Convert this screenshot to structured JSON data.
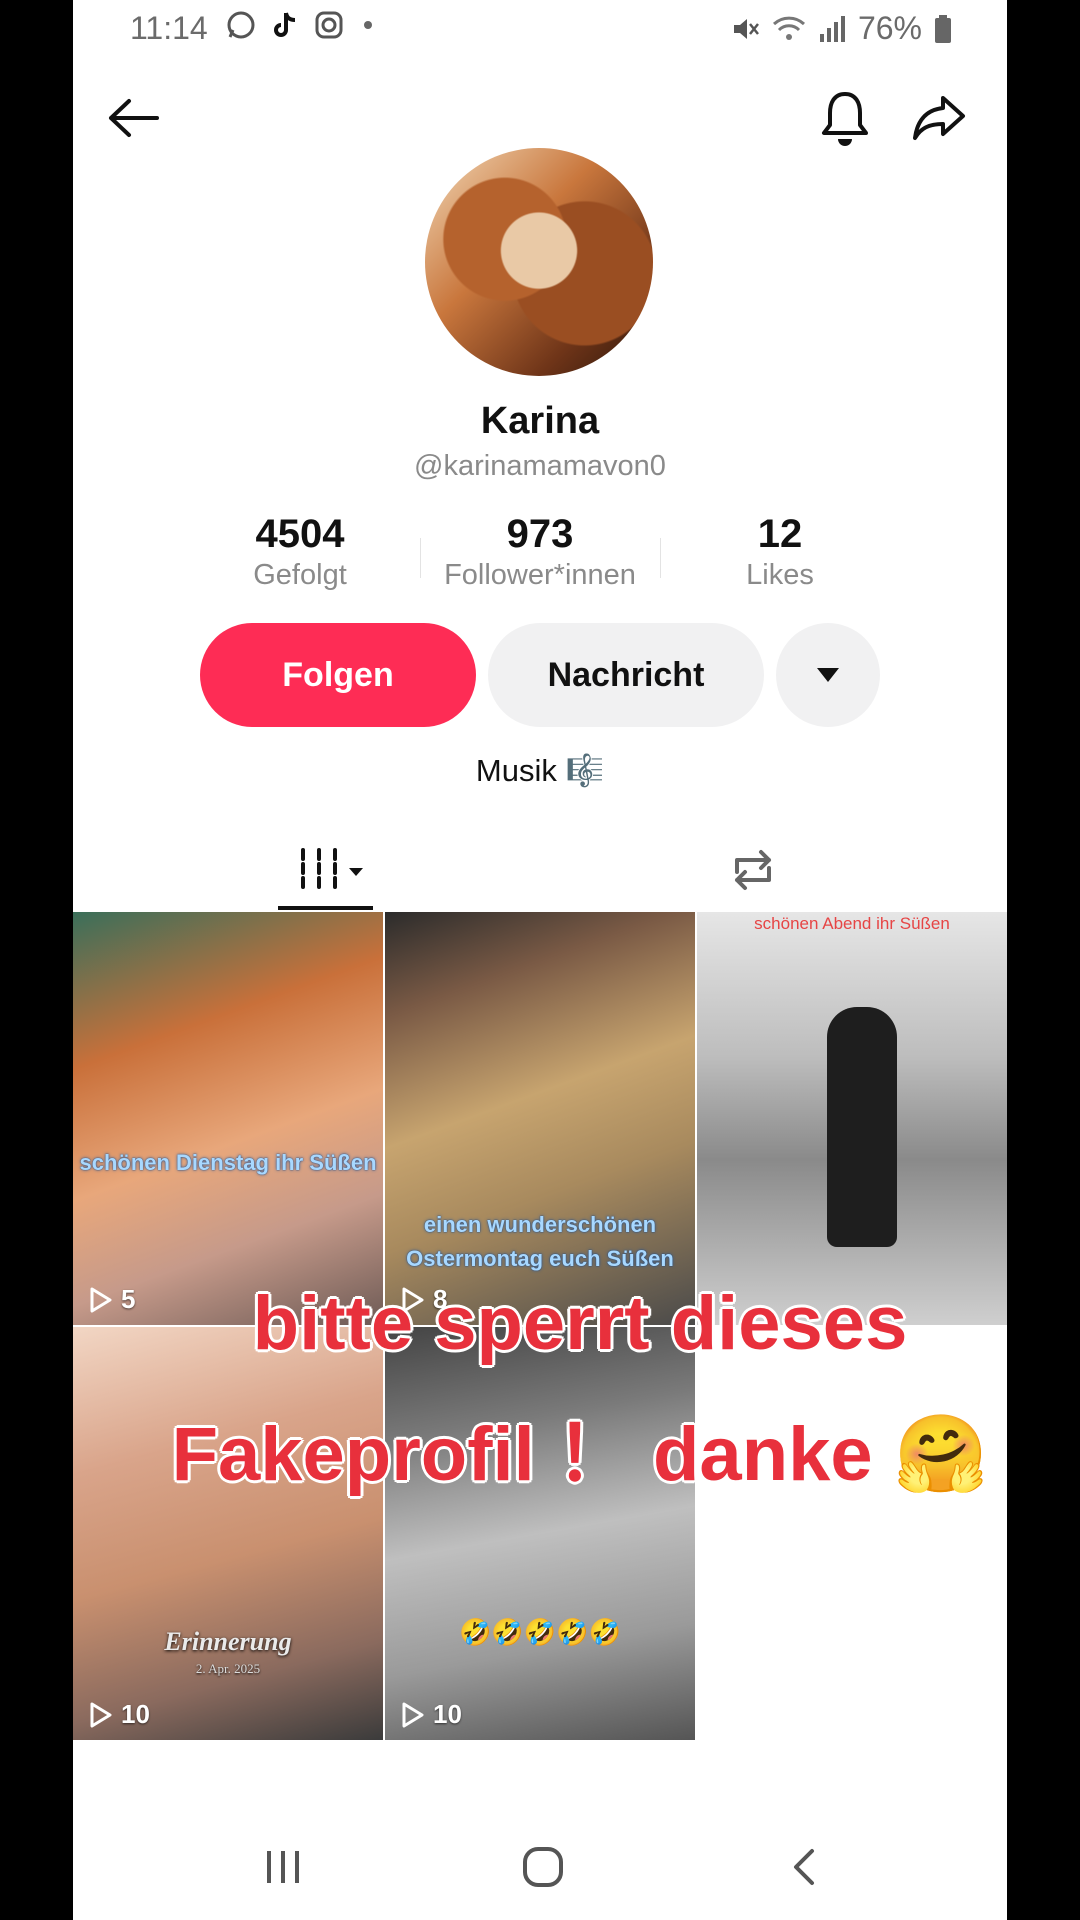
{
  "status": {
    "time": "11:14",
    "battery": "76%"
  },
  "profile": {
    "name": "Karina",
    "handle": "@karinamamavon0",
    "bio": "Musik 🎼"
  },
  "stats": [
    {
      "value": "4504",
      "label": "Gefolgt"
    },
    {
      "value": "973",
      "label": "Follower*innen"
    },
    {
      "value": "12",
      "label": "Likes"
    }
  ],
  "actions": {
    "follow": "Folgen",
    "message": "Nachricht"
  },
  "videos": [
    {
      "caption1": "schönen Dienstag ihr Süßen",
      "caption2": "",
      "views": "5"
    },
    {
      "caption1": "einen wunderschönen",
      "caption2": "Ostermontag euch Süßen",
      "views": "8"
    },
    {
      "caption1": "schönen Abend ihr Süßen",
      "caption2": "",
      "views": ""
    },
    {
      "caption1": "Erinnerung",
      "caption2": "2. Apr. 2025",
      "views": "10"
    },
    {
      "caption1": "🤣🤣🤣🤣🤣",
      "caption2": "",
      "views": "10"
    }
  ],
  "overlay": {
    "line1": "bitte sperrt dieses",
    "line2": "Fakeprofil ！ danke 🤗"
  },
  "colors": {
    "accent": "#fe2c55",
    "overlay_text": "#e8303c"
  }
}
